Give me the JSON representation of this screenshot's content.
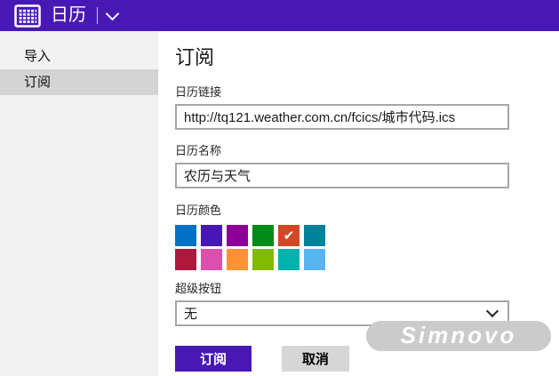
{
  "header": {
    "title": "日历",
    "icons": {
      "app": "calendar-grid-icon",
      "dropdown": "chevron-down-icon"
    }
  },
  "sidebar": {
    "items": [
      {
        "label": "导入",
        "selected": false
      },
      {
        "label": "订阅",
        "selected": true
      }
    ]
  },
  "main": {
    "heading": "订阅",
    "link_label": "日历链接",
    "link_value": "http://tq121.weather.com.cn/fcics/城市代码.ics",
    "name_label": "日历名称",
    "name_value": "农历与天气",
    "color_label": "日历颜色",
    "charm_label": "超级按钮",
    "charm_value": "无",
    "subscribe_button": "订阅",
    "cancel_button": "取消"
  },
  "colors": {
    "accent": "#4818B4",
    "sidebar_bg": "#F2F2F2",
    "sidebar_selected_bg": "#D4D4D4",
    "input_border": "#A6A6A6",
    "selected_index": 4,
    "swatches": [
      "#0072C6",
      "#4617B4",
      "#8C0095",
      "#008A17",
      "#D24726",
      "#008299",
      "#AC193D",
      "#DC4FAD",
      "#FF9333",
      "#82BA00",
      "#00B2AD",
      "#59B4F2"
    ]
  },
  "icons": {
    "check_glyph": "✔",
    "select_chevron": "chevron-down-icon"
  },
  "watermark": {
    "text": "Simnovo"
  }
}
